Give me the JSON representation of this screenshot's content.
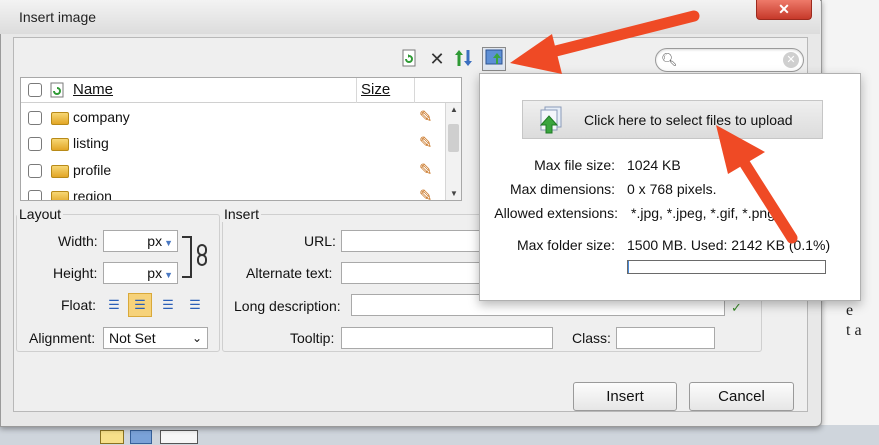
{
  "dialog": {
    "title": "Insert image",
    "close_label": "x"
  },
  "toolbar": {
    "icons": [
      "refresh-icon",
      "delete-icon",
      "sort-icon",
      "upload-image-icon"
    ],
    "search": {
      "value": "",
      "placeholder": ""
    }
  },
  "file_list": {
    "columns": {
      "name": "Name",
      "size": "Size"
    },
    "rows": [
      {
        "name": "company",
        "size": ""
      },
      {
        "name": "listing",
        "size": ""
      },
      {
        "name": "profile",
        "size": ""
      },
      {
        "name": "region",
        "size": ""
      }
    ]
  },
  "layout": {
    "heading": "Layout",
    "width_label": "Width:",
    "height_label": "Height:",
    "unit": "px",
    "float_label": "Float:",
    "alignment_label": "Alignment:",
    "alignment_value": "Not Set",
    "float_selected": 1
  },
  "insert": {
    "heading": "Insert",
    "url_label": "URL:",
    "alt_label": "Alternate text:",
    "longdesc_label": "Long description:",
    "tooltip_label": "Tooltip:",
    "class_label": "Class:"
  },
  "buttons": {
    "insert": "Insert",
    "cancel": "Cancel"
  },
  "upload_popup": {
    "button_label": "Click here to select files to upload",
    "max_file_size_label": "Max file size:",
    "max_file_size_value": "1024 KB",
    "max_dimensions_label": "Max dimensions:",
    "max_dimensions_value": "0 x 768 pixels.",
    "allowed_ext_label": "Allowed extensions:",
    "allowed_ext_value": "*.jpg, *.jpeg, *.gif, *.png",
    "max_folder_label": "Max folder size:",
    "max_folder_value": "1500 MB. Used: 2142 KB (0.1%)",
    "usage_fraction": 0.001
  },
  "background_page": {
    "text_fragments": [
      "e",
      "t a"
    ]
  },
  "colors": {
    "arrow": "#ef4a25",
    "close_button": "#d34a3a",
    "float_selected": "#f6d27a"
  }
}
